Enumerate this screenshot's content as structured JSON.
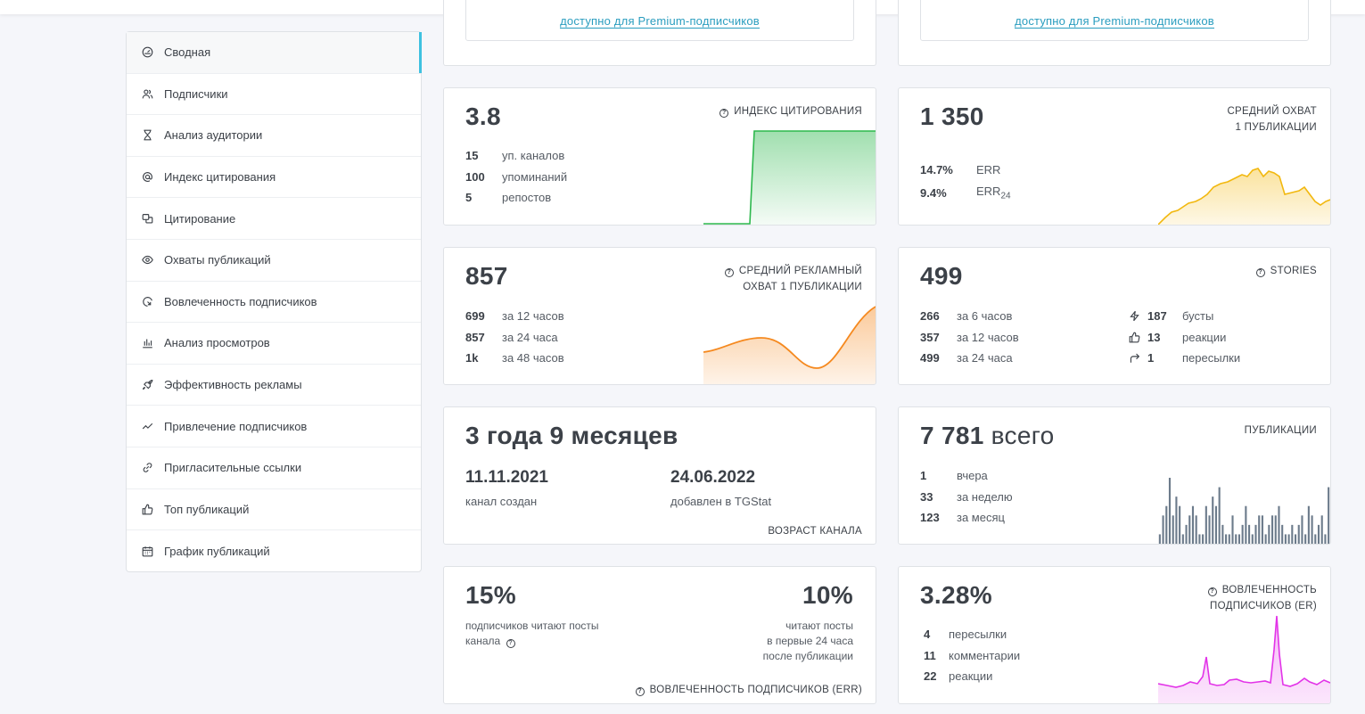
{
  "sidebar": {
    "items": [
      {
        "label": "Сводная",
        "icon": "dashboard-icon",
        "active": true
      },
      {
        "label": "Подписчики",
        "icon": "users-icon"
      },
      {
        "label": "Анализ аудитории",
        "icon": "hourglass-icon"
      },
      {
        "label": "Индекс цитирования",
        "icon": "at-icon"
      },
      {
        "label": "Цитирование",
        "icon": "quote-icon"
      },
      {
        "label": "Охваты публикаций",
        "icon": "eye-icon"
      },
      {
        "label": "Вовлеченность подписчиков",
        "icon": "engagement-icon"
      },
      {
        "label": "Анализ просмотров",
        "icon": "bar-chart-icon"
      },
      {
        "label": "Эффективность рекламы",
        "icon": "rocket-icon"
      },
      {
        "label": "Привлечение подписчиков",
        "icon": "trend-icon"
      },
      {
        "label": "Пригласительные ссылки",
        "icon": "link-icon"
      },
      {
        "label": "Топ публикаций",
        "icon": "thumbs-up-icon"
      },
      {
        "label": "График публикаций",
        "icon": "calendar-icon"
      }
    ]
  },
  "premium": {
    "left_link": "доступно для Premium-подписчиков",
    "right_link": "доступно для Premium-подписчиков"
  },
  "citation": {
    "value": "3.8",
    "label": "ИНДЕКС ЦИТИРОВАНИЯ",
    "rows": [
      {
        "v": "15",
        "t": "уп. каналов"
      },
      {
        "v": "100",
        "t": "упоминаний"
      },
      {
        "v": "5",
        "t": "репостов"
      }
    ],
    "color": "#2db84d"
  },
  "reach": {
    "value": "1 350",
    "label_line1": "СРЕДНИЙ ОХВАТ",
    "label_line2": "1 ПУБЛИКАЦИИ",
    "rows": [
      {
        "v": "14.7%",
        "t": "ERR",
        "sub": ""
      },
      {
        "v": "9.4%",
        "t": "ERR",
        "sub": "24"
      }
    ],
    "color": "#f2b80f"
  },
  "adreach": {
    "value": "857",
    "label_line1": "СРЕДНИЙ РЕКЛАМНЫЙ",
    "label_line2": "ОХВАТ 1 ПУБЛИКАЦИИ",
    "rows": [
      {
        "v": "699",
        "t": "за 12 часов"
      },
      {
        "v": "857",
        "t": "за 24 часа"
      },
      {
        "v": "1k",
        "t": "за 48 часов"
      }
    ],
    "color": "#f5891f"
  },
  "stories": {
    "value": "499",
    "label": "STORIES",
    "rows": [
      {
        "v": "266",
        "t": "за 6 часов"
      },
      {
        "v": "357",
        "t": "за 12 часов"
      },
      {
        "v": "499",
        "t": "за 24 часа"
      }
    ],
    "stats": [
      {
        "icon": "bolt-icon",
        "v": "187",
        "t": "бусты"
      },
      {
        "icon": "thumbs-up-icon",
        "v": "13",
        "t": "реакции"
      },
      {
        "icon": "share-icon",
        "v": "1",
        "t": "пересылки"
      }
    ]
  },
  "age": {
    "value": "3 года 9 месяцев",
    "created_date": "11.11.2021",
    "created_label": "канал создан",
    "added_date": "24.06.2022",
    "added_label": "добавлен в TGStat",
    "label": "ВОЗРАСТ КАНАЛА"
  },
  "posts": {
    "value": "7 781",
    "value_suffix": "всего",
    "label": "ПУБЛИКАЦИИ",
    "rows": [
      {
        "v": "1",
        "t": "вчера"
      },
      {
        "v": "33",
        "t": "за неделю"
      },
      {
        "v": "123",
        "t": "за месяц"
      }
    ],
    "bars": [
      1,
      3,
      4,
      7,
      3,
      5,
      4,
      1,
      2,
      3,
      4,
      3,
      1,
      1,
      4,
      3,
      5,
      4,
      6,
      2,
      1,
      1,
      3,
      1,
      1,
      2,
      4,
      2,
      1,
      2,
      3,
      3,
      1,
      2,
      3,
      3,
      4,
      2,
      1,
      1,
      2,
      1,
      2,
      3,
      1,
      4,
      3,
      1,
      2,
      3,
      1,
      6
    ],
    "color": "#6c7b8b"
  },
  "err": {
    "left_value": "15%",
    "left_text_line1": "подписчиков читают посты",
    "left_text_line2": "канала",
    "right_value": "10%",
    "right_text_line1": "читают посты",
    "right_text_line2": "в первые 24 часа",
    "right_text_line3": "после публикации",
    "label": "ВОВЛЕЧЕННОСТЬ ПОДПИСЧИКОВ (ERR)"
  },
  "er": {
    "value": "3.28%",
    "label_line1": "ВОВЛЕЧЕННОСТЬ",
    "label_line2": "ПОДПИСЧИКОВ (ER)",
    "rows": [
      {
        "v": "4",
        "t": "пересылки"
      },
      {
        "v": "11",
        "t": "комментарии"
      },
      {
        "v": "22",
        "t": "реакции"
      }
    ],
    "color": "#e233e8"
  }
}
